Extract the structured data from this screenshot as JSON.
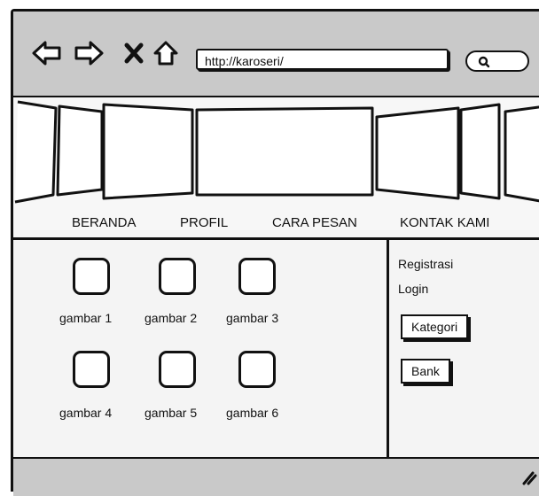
{
  "browser": {
    "url": "http://karoseri/",
    "icons": [
      "back-arrow-icon",
      "forward-arrow-icon",
      "close-x-icon",
      "home-icon",
      "search-icon"
    ]
  },
  "banner": {
    "type": "coverflow-image-carousel"
  },
  "menu": {
    "items": [
      "BERANDA",
      "PROFIL",
      "CARA PESAN",
      "KONTAK KAMI"
    ]
  },
  "gallery": {
    "items": [
      "gambar 1",
      "gambar 2",
      "gambar 3",
      "gambar 4",
      "gambar 5",
      "gambar 6"
    ]
  },
  "sidebar": {
    "links": [
      "Registrasi",
      "Login"
    ],
    "buttons": [
      "Kategori",
      "Bank"
    ]
  },
  "colors": {
    "chrome": "#c9c9c9",
    "background": "#f4f4f4",
    "ink": "#111111"
  }
}
